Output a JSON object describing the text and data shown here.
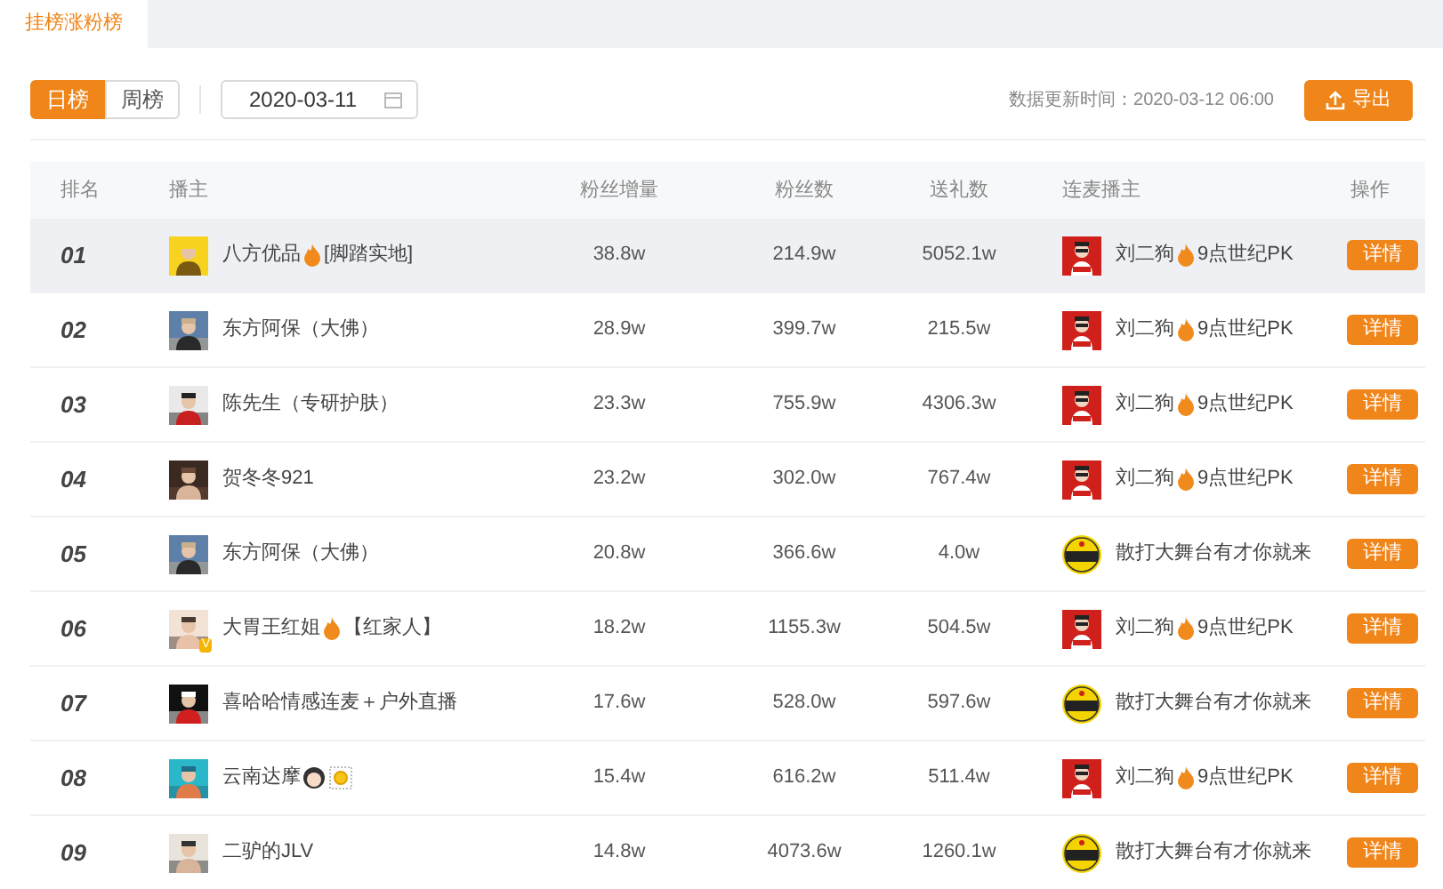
{
  "tabs": [
    {
      "label": "挂榜涨粉榜",
      "selected": true
    }
  ],
  "period_toggle": [
    {
      "label": "日榜",
      "selected": true
    },
    {
      "label": "周榜",
      "selected": false
    }
  ],
  "date_field": {
    "value": "2020-03-11"
  },
  "update_time": "数据更新时间：2020-03-12 06:00",
  "export_button": "导出",
  "table": {
    "columns": [
      "排名",
      "播主",
      "粉丝增量",
      "粉丝数",
      "送礼数",
      "连麦播主",
      "操作"
    ],
    "rows": [
      {
        "rank": "01",
        "highlighted": true,
        "name": [
          {
            "kind": "text",
            "text": "八方优品"
          },
          {
            "kind": "fire"
          },
          {
            "kind": "text",
            "text": "[脚踏实地]"
          }
        ],
        "fan_increase": "38.8w",
        "fans": "214.9w",
        "gifts": "5052.1w",
        "cohost_avatar": {
          "kind": "square"
        },
        "cohost": [
          {
            "kind": "text",
            "text": "刘二狗"
          },
          {
            "kind": "fire"
          },
          {
            "kind": "text",
            "text": "9点世纪PK"
          }
        ],
        "action": "详情"
      },
      {
        "rank": "02",
        "highlighted": false,
        "name": [
          {
            "kind": "text",
            "text": "东方阿保（大佛）"
          }
        ],
        "fan_increase": "28.9w",
        "fans": "399.7w",
        "gifts": "215.5w",
        "cohost_avatar": {
          "kind": "square"
        },
        "cohost": [
          {
            "kind": "text",
            "text": "刘二狗"
          },
          {
            "kind": "fire"
          },
          {
            "kind": "text",
            "text": "9点世纪PK"
          }
        ],
        "action": "详情"
      },
      {
        "rank": "03",
        "highlighted": false,
        "name": [
          {
            "kind": "text",
            "text": "陈先生（专研护肤）"
          }
        ],
        "fan_increase": "23.3w",
        "fans": "755.9w",
        "gifts": "4306.3w",
        "cohost_avatar": {
          "kind": "square"
        },
        "cohost": [
          {
            "kind": "text",
            "text": "刘二狗"
          },
          {
            "kind": "fire"
          },
          {
            "kind": "text",
            "text": "9点世纪PK"
          }
        ],
        "action": "详情"
      },
      {
        "rank": "04",
        "highlighted": false,
        "name": [
          {
            "kind": "text",
            "text": "贺冬冬921"
          }
        ],
        "fan_increase": "23.2w",
        "fans": "302.0w",
        "gifts": "767.4w",
        "cohost_avatar": {
          "kind": "square"
        },
        "cohost": [
          {
            "kind": "text",
            "text": "刘二狗"
          },
          {
            "kind": "fire"
          },
          {
            "kind": "text",
            "text": "9点世纪PK"
          }
        ],
        "action": "详情"
      },
      {
        "rank": "05",
        "highlighted": false,
        "name": [
          {
            "kind": "text",
            "text": "东方阿保（大佛）"
          }
        ],
        "fan_increase": "20.8w",
        "fans": "366.6w",
        "gifts": "4.0w",
        "cohost_avatar": {
          "kind": "circle"
        },
        "cohost": [
          {
            "kind": "text",
            "text": "散打大舞台有才你就来"
          }
        ],
        "action": "详情"
      },
      {
        "rank": "06",
        "highlighted": false,
        "badge": "V",
        "name": [
          {
            "kind": "text",
            "text": "大胃王红姐"
          },
          {
            "kind": "fire"
          },
          {
            "kind": "text",
            "text": "【红家人】"
          }
        ],
        "fan_increase": "18.2w",
        "fans": "1155.3w",
        "gifts": "504.5w",
        "cohost_avatar": {
          "kind": "square"
        },
        "cohost": [
          {
            "kind": "text",
            "text": "刘二狗"
          },
          {
            "kind": "fire"
          },
          {
            "kind": "text",
            "text": "9点世纪PK"
          }
        ],
        "action": "详情"
      },
      {
        "rank": "07",
        "highlighted": false,
        "name": [
          {
            "kind": "text",
            "text": "喜哈哈情感连麦＋户外直播"
          }
        ],
        "fan_increase": "17.6w",
        "fans": "528.0w",
        "gifts": "597.6w",
        "cohost_avatar": {
          "kind": "circle"
        },
        "cohost": [
          {
            "kind": "text",
            "text": "散打大舞台有才你就来"
          }
        ],
        "action": "详情"
      },
      {
        "rank": "08",
        "highlighted": false,
        "name": [
          {
            "kind": "text",
            "text": "云南达摩"
          },
          {
            "kind": "girl"
          },
          {
            "kind": "sun"
          }
        ],
        "fan_increase": "15.4w",
        "fans": "616.2w",
        "gifts": "511.4w",
        "cohost_avatar": {
          "kind": "square"
        },
        "cohost": [
          {
            "kind": "text",
            "text": "刘二狗"
          },
          {
            "kind": "fire"
          },
          {
            "kind": "text",
            "text": "9点世纪PK"
          }
        ],
        "action": "详情"
      },
      {
        "rank": "09",
        "highlighted": false,
        "name": [
          {
            "kind": "text",
            "text": "二驴的JLV"
          }
        ],
        "fan_increase": "14.8w",
        "fans": "4073.6w",
        "gifts": "1260.1w",
        "cohost_avatar": {
          "kind": "circle"
        },
        "cohost": [
          {
            "kind": "text",
            "text": "散打大舞台有才你就来"
          }
        ],
        "action": "详情"
      }
    ]
  }
}
